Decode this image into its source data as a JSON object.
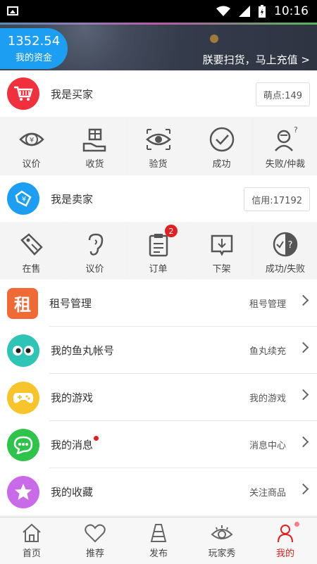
{
  "status_bar": {
    "time": "10:16"
  },
  "banner": {
    "balance": "1352.54",
    "balance_label": "我的资金",
    "recharge_link": "朕要扫货，马上充值 >"
  },
  "buyer": {
    "title": "我是买家",
    "points": "萌点:149",
    "actions": [
      {
        "label": "议价",
        "icon": "bargain-icon"
      },
      {
        "label": "收货",
        "icon": "receive-goods-icon"
      },
      {
        "label": "验货",
        "icon": "inspect-icon"
      },
      {
        "label": "成功",
        "icon": "success-icon"
      },
      {
        "label": "失败/仲裁",
        "icon": "arbitration-icon"
      }
    ]
  },
  "seller": {
    "title": "我是卖家",
    "credit": "信用:17192",
    "actions": [
      {
        "label": "在售",
        "icon": "on-sale-icon"
      },
      {
        "label": "议价",
        "icon": "bargain-ear-icon"
      },
      {
        "label": "订单",
        "icon": "order-icon",
        "badge": "2"
      },
      {
        "label": "下架",
        "icon": "take-down-icon"
      },
      {
        "label": "成功/失败",
        "icon": "success-fail-icon"
      }
    ]
  },
  "menu": [
    {
      "title": "租号管理",
      "sub": "租号管理",
      "icon": "rent-icon",
      "icon_text": "租",
      "color": "#f06a35"
    },
    {
      "title": "我的鱼丸帐号",
      "sub": "鱼丸续充",
      "icon": "fishball-icon",
      "color": "#2ec4b6"
    },
    {
      "title": "我的游戏",
      "sub": "我的游戏",
      "icon": "gamepad-icon",
      "color": "#f7c52b"
    },
    {
      "title": "我的消息",
      "sub": "消息中心",
      "icon": "message-icon",
      "color": "#2ec44a"
    },
    {
      "title": "我的收藏",
      "sub": "关注商品",
      "icon": "star-icon",
      "color": "#c96be8"
    }
  ],
  "tabs": [
    {
      "label": "首页",
      "icon": "home-icon"
    },
    {
      "label": "推荐",
      "icon": "heart-icon"
    },
    {
      "label": "发布",
      "icon": "publish-icon"
    },
    {
      "label": "玩家秀",
      "icon": "eye-icon"
    },
    {
      "label": "我的",
      "icon": "user-icon",
      "active": true
    }
  ],
  "colors": {
    "accent": "#1c9ef2",
    "cart": "#f0303c",
    "tag": "#1c9ef2",
    "active_tab": "#e02020"
  }
}
